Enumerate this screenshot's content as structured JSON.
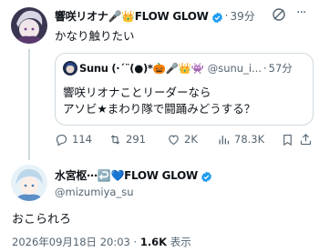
{
  "post": {
    "display_name": "響咲リオナ🎤👑FLOW GLOW",
    "separator": "·",
    "time": "39分",
    "text": "かなり触りたい",
    "grok_icon": "grok-icon",
    "more_icon": "more-icon"
  },
  "quote": {
    "display_name": "Sunu (·´¨(●)*🎃🎤👑👾",
    "handle": "@sunu_i...",
    "separator": "·",
    "time": "57分",
    "text_line1": "響咲リオナことリーダーなら",
    "text_line2": "アソビ★まわり隊で闘踊みどうする？"
  },
  "actions": {
    "replies": "114",
    "reposts": "291",
    "likes": "2K",
    "views": "78.3K",
    "reply_icon": "reply-icon",
    "repost_icon": "repost-icon",
    "like_icon": "heart-icon",
    "views_icon": "views-icon",
    "bookmark_icon": "bookmark-icon",
    "share_icon": "share-icon"
  },
  "reply": {
    "display_name": "水宮枢⋯↩️💙FLOW GLOW",
    "handle": "@mizumiya_su",
    "text": "おこられろ",
    "timestamp": "2026年09月18日 20:03",
    "separator": "·",
    "views_count": "1.6K",
    "views_label": "表示"
  },
  "colors": {
    "verified": "#1d9bf0",
    "secondary_text": "#536471",
    "border": "#cfd9de"
  }
}
